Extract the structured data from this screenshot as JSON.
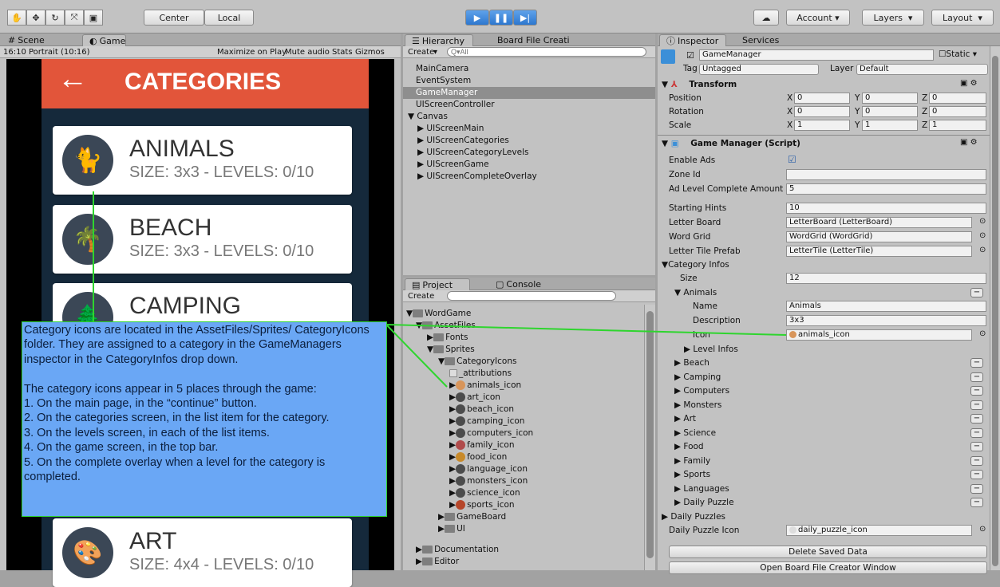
{
  "toolbar": {
    "center": "Center",
    "local": "Local",
    "account": "Account",
    "layers": "Layers",
    "layout": "Layout",
    "play_icon": "play-icon",
    "pause_icon": "pause-icon",
    "step_icon": "step-icon"
  },
  "game": {
    "scene_tab": "Scene",
    "game_tab": "Game",
    "aspect": "16:10 Portrait (10:16)",
    "maximize": "Maximize on Play",
    "mute": "Mute audio",
    "stats": "Stats",
    "gizmos": "Gizmos",
    "header_title": "CATEGORIES",
    "cards": [
      {
        "title": "ANIMALS",
        "subtitle": "SIZE: 3x3 - LEVELS: 0/10"
      },
      {
        "title": "BEACH",
        "subtitle": "SIZE: 3x3 - LEVELS: 0/10"
      },
      {
        "title": "CAMPING",
        "subtitle": ""
      },
      {
        "title": "ART",
        "subtitle": "SIZE: 4x4 - LEVELS: 0/10"
      }
    ],
    "colors": {
      "header": "#e2553a",
      "bg": "#15293b",
      "annotation": "#6aa7f5",
      "line": "#2ed52e"
    }
  },
  "hierarchy": {
    "tab": "Hierarchy",
    "tab2": "Board File Creatі",
    "create": "Create",
    "search_placeholder": "Q▾All",
    "items": [
      "MainCamera",
      "EventSystem",
      "GameManager",
      "UIScreenController",
      "Canvas",
      "UIScreenMain",
      "UIScreenCategories",
      "UIScreenCategoryLevels",
      "UIScreenGame",
      "UIScreenCompleteOverlay"
    ]
  },
  "project": {
    "tab": "Project",
    "tab2": "Console",
    "create": "Create",
    "items": [
      "WordGame",
      "AssetFiles",
      "Fonts",
      "Sprites",
      "CategoryIcons",
      "_attributions",
      "animals_icon",
      "art_icon",
      "beach_icon",
      "camping_icon",
      "computers_icon",
      "family_icon",
      "food_icon",
      "language_icon",
      "monsters_icon",
      "science_icon",
      "sports_icon",
      "GameBoard",
      "UI",
      "Documentation",
      "Editor"
    ]
  },
  "annotation": {
    "text": "Category icons are located in the AssetFiles/Sprites/ CategoryIcons folder. They are assigned to a category in the GameManagers inspector in the CategoryInfos drop down.\n\nThe category icons appear in 5 places through the game:\n1. On the main page, in the “continue” button.\n2. On the categories screen, in the list item for the category.\n3. On the levels screen, in each of the list items.\n4. On the game screen, in the top bar.\n5. On the complete overlay when a level for the category is completed."
  },
  "inspector": {
    "tab": "Inspector",
    "tab2": "Services",
    "object_name": "GameManager",
    "static": "Static",
    "tag_label": "Tag",
    "tag": "Untagged",
    "layer_label": "Layer",
    "layer": "Default",
    "transform": {
      "title": "Transform",
      "position": "Position",
      "rotation": "Rotation",
      "scale": "Scale",
      "x": "X",
      "y": "Y",
      "z": "Z",
      "pos": [
        "0",
        "0",
        "0"
      ],
      "rot": [
        "0",
        "0",
        "0"
      ],
      "scl": [
        "1",
        "1",
        "1"
      ]
    },
    "script": {
      "title": "Game Manager (Script)",
      "enable_ads": "Enable Ads",
      "zone_id": "Zone Id",
      "ad_level": "Ad Level Complete Amount",
      "ad_level_val": "5",
      "starting_hints": "Starting Hints",
      "starting_hints_val": "10",
      "letter_board": "Letter Board",
      "letter_board_val": "LetterBoard (LetterBoard)",
      "word_grid": "Word Grid",
      "word_grid_val": "WordGrid (WordGrid)",
      "letter_tile": "Letter Tile Prefab",
      "letter_tile_val": "LetterTile (LetterTile)",
      "category_infos": "Category Infos",
      "size": "Size",
      "size_val": "12",
      "animals": "Animals",
      "name": "Name",
      "name_val": "Animals",
      "description": "Description",
      "description_val": "3x3",
      "icon": "Icon",
      "icon_val": "animals_icon",
      "level_infos": "Level Infos",
      "categories": [
        "Beach",
        "Camping",
        "Computers",
        "Monsters",
        "Art",
        "Science",
        "Food",
        "Family",
        "Sports",
        "Languages",
        "Daily Puzzle"
      ],
      "daily_puzzles": "Daily Puzzles",
      "daily_puzzle_icon": "Daily Puzzle Icon",
      "daily_puzzle_icon_val": "daily_puzzle_icon",
      "delete_saved": "Delete Saved Data",
      "open_board": "Open Board File Creator Window"
    }
  }
}
